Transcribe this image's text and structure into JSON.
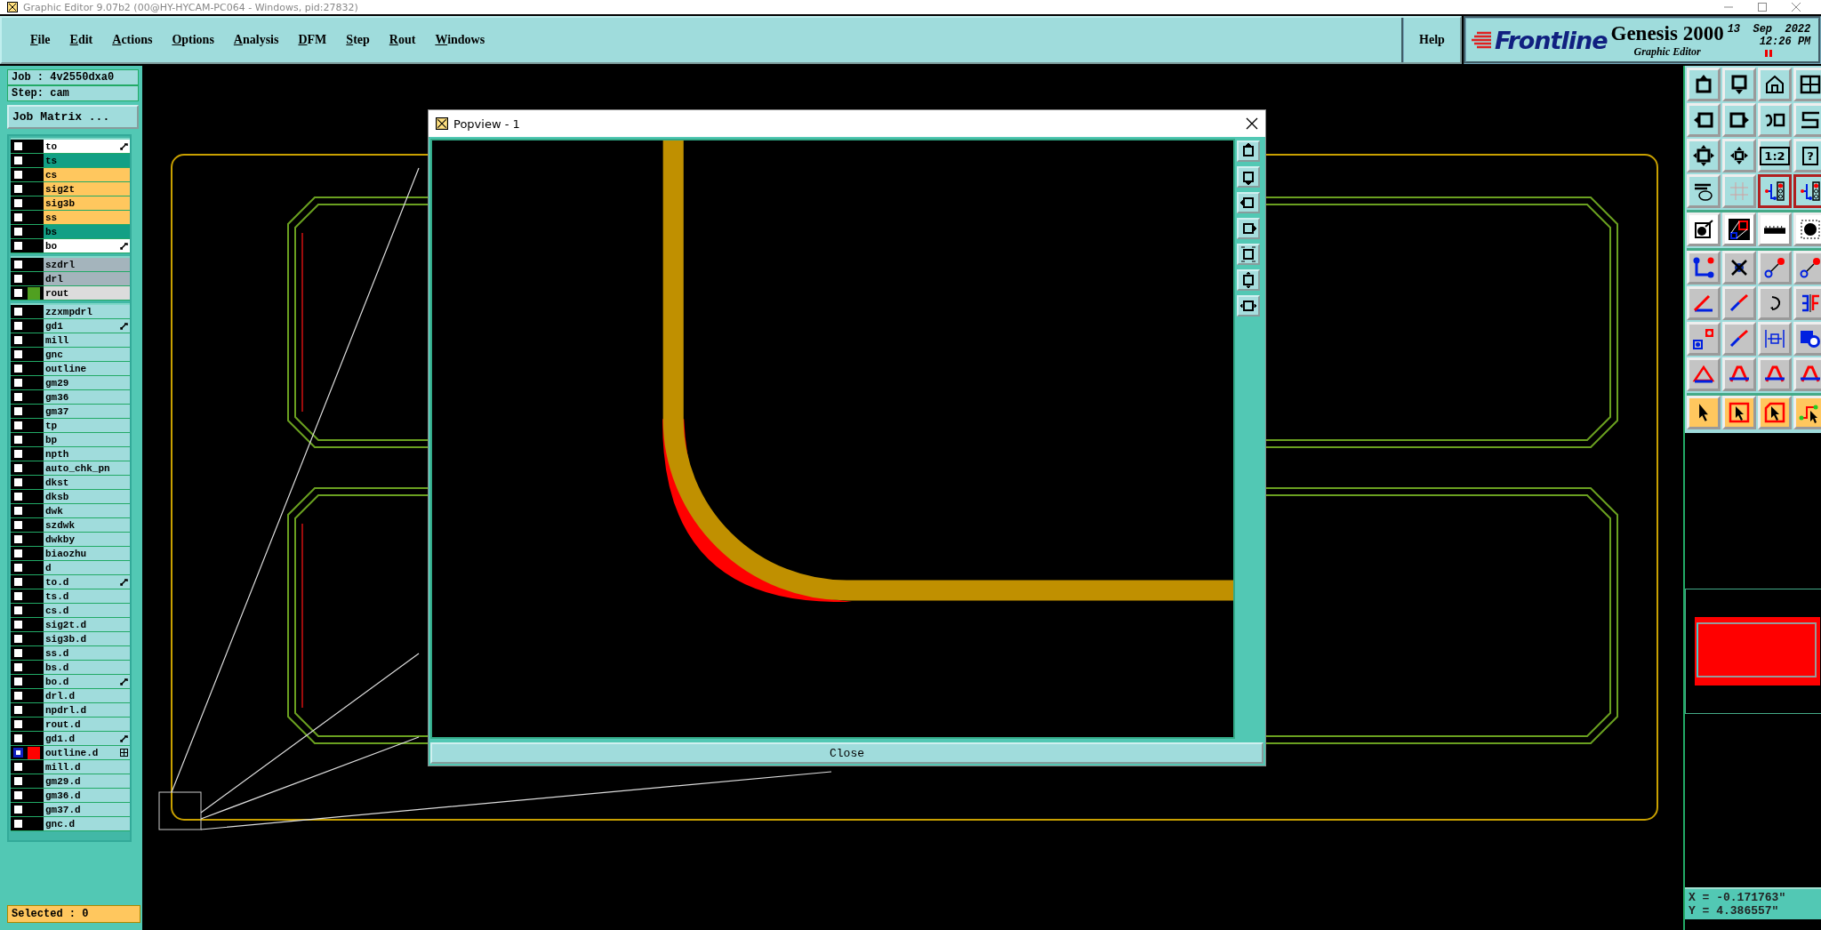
{
  "window": {
    "title": "Graphic Editor 9.07b2 (00@HY-HYCAM-PC064 - Windows, pid:27832)"
  },
  "menu": [
    "File",
    "Edit",
    "Actions",
    "Options",
    "Analysis",
    "DFM",
    "Step",
    "Rout",
    "Windows"
  ],
  "help": "Help",
  "brand": {
    "logo": "Frontline",
    "product": "Genesis 2000",
    "subtitle": "Graphic Editor",
    "date": "13  Sep  2022",
    "time": "12:26 PM"
  },
  "job": {
    "job": "Job : 4v2550dxa0",
    "step": "Step: cam",
    "matrix_button": "Job Matrix ..."
  },
  "layer_groups": [
    [
      {
        "name": "to",
        "color": "#ffffff",
        "affected": false,
        "kind": "arrow"
      },
      {
        "name": "ts",
        "color": "#12a085",
        "affected": false,
        "kind": "plain"
      },
      {
        "name": "cs",
        "color": "#ffc75e",
        "affected": false,
        "kind": "plain"
      },
      {
        "name": "sig2t",
        "color": "#ffc75e",
        "affected": false,
        "kind": "plain"
      },
      {
        "name": "sig3b",
        "color": "#ffc75e",
        "affected": false,
        "kind": "plain"
      },
      {
        "name": "ss",
        "color": "#ffc75e",
        "affected": false,
        "kind": "plain"
      },
      {
        "name": "bs",
        "color": "#12a085",
        "affected": false,
        "kind": "plain"
      },
      {
        "name": "bo",
        "color": "#ffffff",
        "affected": false,
        "kind": "arrow"
      }
    ],
    [
      {
        "name": "szdrl",
        "color": "#a4b4bc",
        "affected": false,
        "kind": "plain"
      },
      {
        "name": "drl",
        "color": "#a4b4bc",
        "affected": false,
        "kind": "plain"
      },
      {
        "name": "rout",
        "color": "#dcdcdc",
        "affected": false,
        "kind": "plain",
        "swatch": {
          "color": "#50a020"
        }
      }
    ],
    [
      {
        "name": "zzxmpdrl",
        "color": "#a0dcdc",
        "affected": false,
        "kind": "plain"
      },
      {
        "name": "gd1",
        "color": "#a0dcdc",
        "affected": false,
        "kind": "arrow"
      },
      {
        "name": "mill",
        "color": "#a0dcdc",
        "affected": false,
        "kind": "plain"
      },
      {
        "name": "gnc",
        "color": "#a0dcdc",
        "affected": false,
        "kind": "plain"
      },
      {
        "name": "outline",
        "color": "#a0dcdc",
        "affected": false,
        "kind": "plain"
      },
      {
        "name": "gm29",
        "color": "#a0dcdc",
        "affected": false,
        "kind": "plain"
      },
      {
        "name": "gm36",
        "color": "#a0dcdc",
        "affected": false,
        "kind": "plain"
      },
      {
        "name": "gm37",
        "color": "#a0dcdc",
        "affected": false,
        "kind": "plain"
      },
      {
        "name": "tp",
        "color": "#a0dcdc",
        "affected": false,
        "kind": "plain"
      },
      {
        "name": "bp",
        "color": "#a0dcdc",
        "affected": false,
        "kind": "plain"
      },
      {
        "name": "npth",
        "color": "#a0dcdc",
        "affected": false,
        "kind": "plain"
      },
      {
        "name": "auto_chk_pn",
        "color": "#a0dcdc",
        "affected": false,
        "kind": "plain"
      },
      {
        "name": "dkst",
        "color": "#a0dcdc",
        "affected": false,
        "kind": "plain"
      },
      {
        "name": "dksb",
        "color": "#a0dcdc",
        "affected": false,
        "kind": "plain"
      },
      {
        "name": "dwk",
        "color": "#a0dcdc",
        "affected": false,
        "kind": "plain"
      },
      {
        "name": "szdwk",
        "color": "#a0dcdc",
        "affected": false,
        "kind": "plain"
      },
      {
        "name": "dwkby",
        "color": "#a0dcdc",
        "affected": false,
        "kind": "plain"
      },
      {
        "name": "biaozhu",
        "color": "#a0dcdc",
        "affected": false,
        "kind": "plain"
      },
      {
        "name": "d",
        "color": "#a0dcdc",
        "affected": false,
        "kind": "plain"
      },
      {
        "name": "to.d",
        "color": "#a0dcdc",
        "affected": false,
        "kind": "arrow"
      },
      {
        "name": "ts.d",
        "color": "#a0dcdc",
        "affected": false,
        "kind": "plain"
      },
      {
        "name": "cs.d",
        "color": "#a0dcdc",
        "affected": false,
        "kind": "plain"
      },
      {
        "name": "sig2t.d",
        "color": "#a0dcdc",
        "affected": false,
        "kind": "plain"
      },
      {
        "name": "sig3b.d",
        "color": "#a0dcdc",
        "affected": false,
        "kind": "plain"
      },
      {
        "name": "ss.d",
        "color": "#a0dcdc",
        "affected": false,
        "kind": "plain"
      },
      {
        "name": "bs.d",
        "color": "#a0dcdc",
        "affected": false,
        "kind": "plain"
      },
      {
        "name": "bo.d",
        "color": "#a0dcdc",
        "affected": false,
        "kind": "arrow"
      },
      {
        "name": "drl.d",
        "color": "#a0dcdc",
        "affected": false,
        "kind": "plain"
      },
      {
        "name": "npdrl.d",
        "color": "#a0dcdc",
        "affected": false,
        "kind": "plain"
      },
      {
        "name": "rout.d",
        "color": "#a0dcdc",
        "affected": false,
        "kind": "plain"
      },
      {
        "name": "gd1.d",
        "color": "#a0dcdc",
        "affected": false,
        "kind": "arrow"
      },
      {
        "name": "outline.d",
        "color": "#a0dcdc",
        "affected": true,
        "kind": "grid",
        "swatch": {
          "color": "#ff0000"
        }
      },
      {
        "name": "mill.d",
        "color": "#a0dcdc",
        "affected": false,
        "kind": "plain"
      },
      {
        "name": "gm29.d",
        "color": "#a0dcdc",
        "affected": false,
        "kind": "plain"
      },
      {
        "name": "gm36.d",
        "color": "#a0dcdc",
        "affected": false,
        "kind": "plain"
      },
      {
        "name": "gm37.d",
        "color": "#a0dcdc",
        "affected": false,
        "kind": "plain"
      },
      {
        "name": "gnc.d",
        "color": "#a0dcdc",
        "affected": false,
        "kind": "plain"
      }
    ]
  ],
  "selected_count": "Selected : 0",
  "popview": {
    "title": "Popview - 1",
    "close_button": "Close"
  },
  "toolbar": [
    {
      "kind": "view",
      "buttons": [
        {
          "kind": "box-up",
          "selected": false
        },
        {
          "kind": "box-down",
          "selected": false
        },
        {
          "kind": "home",
          "selected": false
        },
        {
          "kind": "window",
          "selected": false
        }
      ]
    },
    {
      "kind": "view",
      "buttons": [
        {
          "kind": "box-left",
          "selected": false
        },
        {
          "kind": "box-right",
          "selected": false
        },
        {
          "kind": "undo",
          "selected": false
        },
        {
          "kind": "s-curve",
          "selected": false
        }
      ]
    },
    {
      "kind": "view",
      "buttons": [
        {
          "kind": "expand",
          "selected": false
        },
        {
          "kind": "fit",
          "selected": false
        },
        {
          "kind": "label",
          "label": "1:2",
          "selected": false
        },
        {
          "kind": "label",
          "label": "?",
          "selected": false
        }
      ]
    },
    {
      "kind": "view",
      "buttons": [
        {
          "kind": "tools",
          "selected": false
        },
        {
          "kind": "grid",
          "selected": false
        },
        {
          "kind": "circuit",
          "selected": true
        },
        {
          "kind": "circuit",
          "selected": true
        }
      ]
    },
    {
      "kind": "display",
      "buttons": [
        {
          "kind": "pad",
          "selected": false
        },
        {
          "kind": "measure",
          "selected": false
        },
        {
          "kind": "ruler",
          "selected": false
        },
        {
          "kind": "dot",
          "selected": false
        }
      ]
    },
    {
      "kind": "edit",
      "buttons": [
        {
          "kind": "nodes",
          "selected": false
        },
        {
          "kind": "cross",
          "selected": false
        },
        {
          "kind": "points",
          "selected": false
        },
        {
          "kind": "points",
          "selected": false
        }
      ]
    },
    {
      "kind": "edit",
      "buttons": [
        {
          "kind": "angle",
          "selected": false
        },
        {
          "kind": "line",
          "selected": false
        },
        {
          "kind": "rotate",
          "selected": false
        },
        {
          "kind": "mirror",
          "selected": false
        }
      ]
    },
    {
      "kind": "edit",
      "buttons": [
        {
          "kind": "pad-move",
          "selected": false
        },
        {
          "kind": "line",
          "selected": false
        },
        {
          "kind": "resize",
          "selected": false
        },
        {
          "kind": "shapes",
          "selected": false
        }
      ]
    },
    {
      "kind": "edit",
      "buttons": [
        {
          "kind": "triangle",
          "selected": false
        },
        {
          "kind": "arch",
          "selected": false
        },
        {
          "kind": "arch",
          "selected": false
        },
        {
          "kind": "arch",
          "selected": false
        }
      ]
    },
    {
      "kind": "select",
      "buttons": [
        {
          "kind": "pointer",
          "selected": false
        },
        {
          "kind": "pointer-box",
          "selected": false
        },
        {
          "kind": "pointer-octagon",
          "selected": false
        },
        {
          "kind": "pointer-path",
          "selected": false
        }
      ]
    }
  ],
  "coordinates": {
    "x": "X = -0.171763\"",
    "y": "Y = 4.386557\""
  }
}
